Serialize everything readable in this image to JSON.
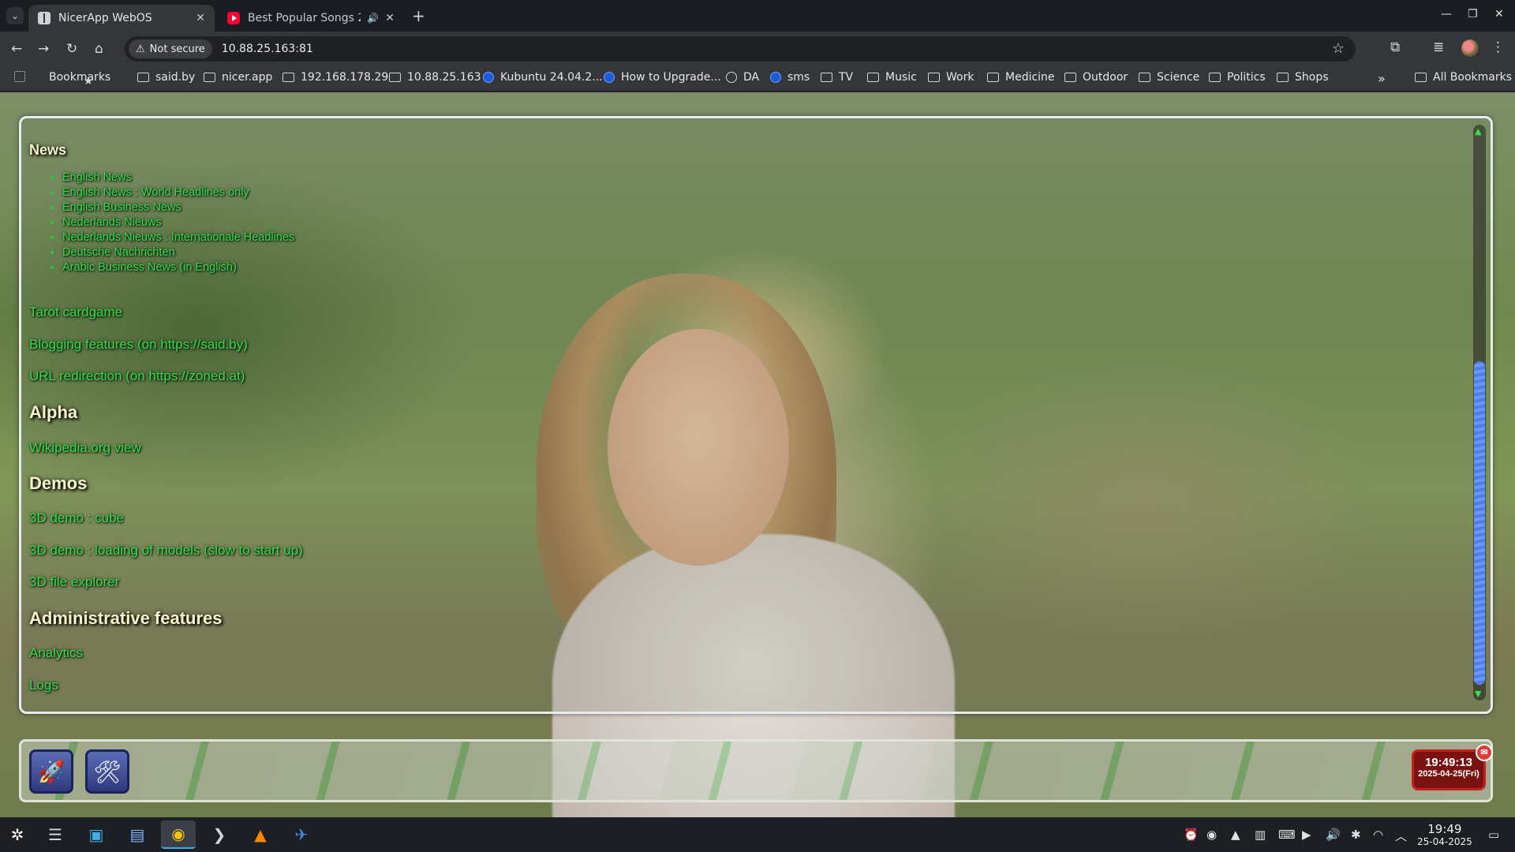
{
  "browser": {
    "tabs": [
      {
        "title": "NicerApp WebOS",
        "active": true
      },
      {
        "title": "Best Popular Songs 202",
        "active": false
      }
    ],
    "new_tab": "+",
    "security_label": "Not secure",
    "url": "10.88.25.163:81",
    "bookmarks": [
      {
        "label": "Bookmarks",
        "icon": "star-icon"
      },
      {
        "label": "said.by",
        "icon": "folder-icon"
      },
      {
        "label": "nicer.app",
        "icon": "folder-icon"
      },
      {
        "label": "192.168.178.29",
        "icon": "folder-icon"
      },
      {
        "label": "10.88.25.163",
        "icon": "folder-icon"
      },
      {
        "label": "Kubuntu 24.04.2...",
        "icon": "kubuntu-icon"
      },
      {
        "label": "How to Upgrade...",
        "icon": "info-icon"
      },
      {
        "label": "DA",
        "icon": "github-icon"
      },
      {
        "label": "sms",
        "icon": "chat-icon"
      },
      {
        "label": "TV",
        "icon": "folder-icon"
      },
      {
        "label": "Music",
        "icon": "folder-icon"
      },
      {
        "label": "Work",
        "icon": "folder-icon"
      },
      {
        "label": "Medicine",
        "icon": "folder-icon"
      },
      {
        "label": "Outdoor",
        "icon": "folder-icon"
      },
      {
        "label": "Science",
        "icon": "folder-icon"
      },
      {
        "label": "Politics",
        "icon": "folder-icon"
      },
      {
        "label": "Shops",
        "icon": "folder-icon"
      }
    ],
    "more": "»",
    "all_bookmarks": "All Bookmarks"
  },
  "page": {
    "news_heading": "News",
    "news_items": [
      "English News",
      "English News : World Headlines only",
      "English Business News",
      "Nederlands Nieuws",
      "Nederlands Nieuws : Internationale Headlines",
      "Deutsche Nachrichten",
      "Arabic Business News (in English)"
    ],
    "tarot": "Tarot cardgame",
    "blogging": "Blogging features (on https://said.by)",
    "url_redirection": "URL redirection (on https://zoned.at)",
    "alpha_heading": "Alpha",
    "wikipedia": "Wikipedia.org view",
    "demos_heading": "Demos",
    "demo_cube": "3D demo : cube",
    "demo_models": "3D demo : loading of models (slow to start up)",
    "demo_explorer": "3D file explorer",
    "admin_heading": "Administrative features",
    "analytics": "Analytics",
    "logs": "Logs"
  },
  "dock": {
    "clock_time": "19:49:13",
    "clock_date": "2025-04-25(Fri)"
  },
  "taskbar": {
    "time": "19:49",
    "date": "25-04-2025"
  },
  "colors": {
    "link": "#2fe04a",
    "heading": "#f6f1c9",
    "clock_bg": "#7a1212"
  }
}
